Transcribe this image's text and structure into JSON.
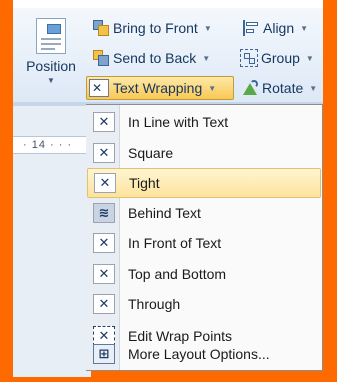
{
  "ribbon": {
    "position_label": "Position",
    "bring_to_front": "Bring to Front",
    "align": "Align",
    "send_to_back": "Send to Back",
    "group": "Group",
    "text_wrapping": "Text Wrapping",
    "rotate": "Rotate"
  },
  "ruler": {
    "text": "· 14 · · ·"
  },
  "menu": {
    "items": [
      {
        "label": "In Line with Text",
        "icon": "inline-wrap-icon"
      },
      {
        "label": "Square",
        "icon": "square-wrap-icon"
      },
      {
        "label": "Tight",
        "icon": "tight-wrap-icon"
      },
      {
        "label": "Behind Text",
        "icon": "behind-text-icon"
      },
      {
        "label": "In Front of Text",
        "icon": "in-front-text-icon"
      },
      {
        "label": "Top and Bottom",
        "icon": "top-bottom-wrap-icon"
      },
      {
        "label": "Through",
        "icon": "through-wrap-icon"
      },
      {
        "label": "Edit Wrap Points",
        "icon": "edit-wrap-points-icon"
      },
      {
        "label": "More Layout Options...",
        "icon": "layout-options-icon"
      }
    ],
    "highlighted_index": 2
  },
  "colors": {
    "frame": "#ff6a00",
    "highlight": "#fde39b"
  }
}
